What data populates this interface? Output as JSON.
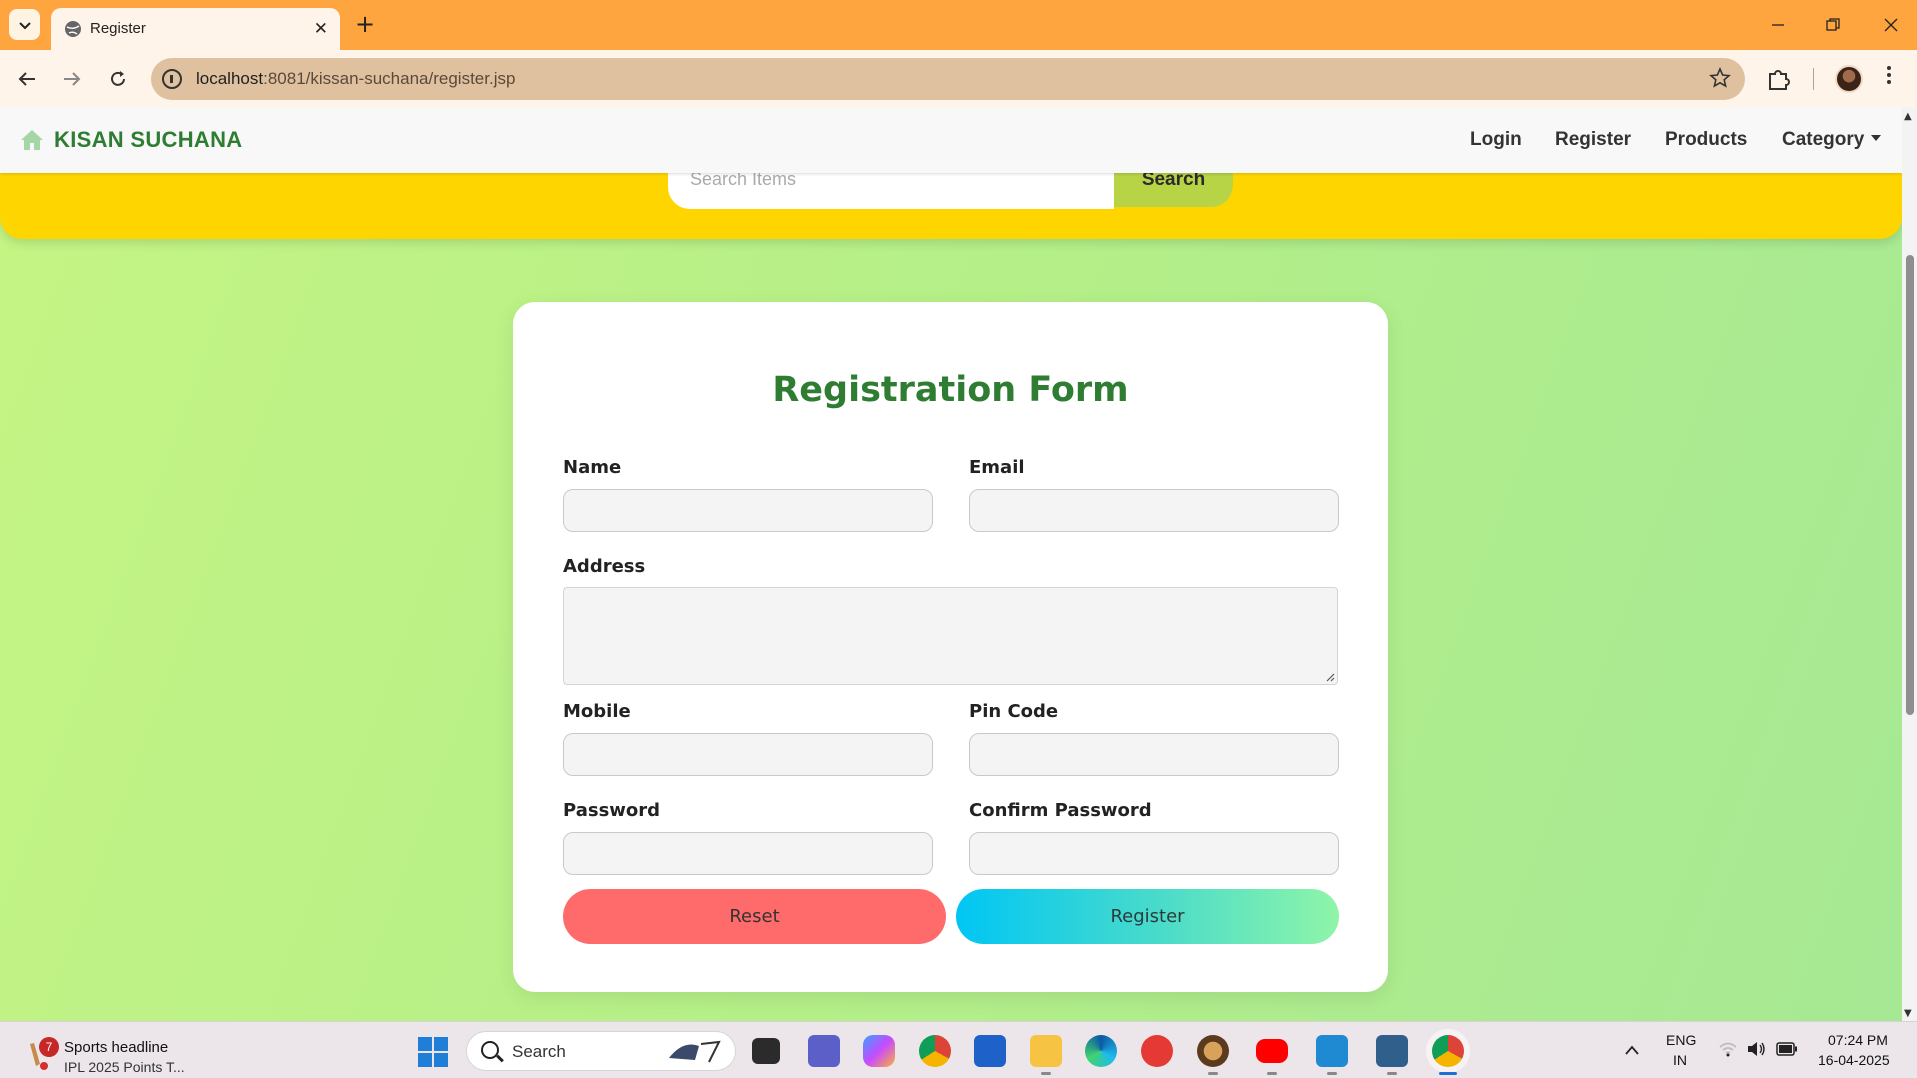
{
  "browser": {
    "tab_title": "Register",
    "close_tab": "✕",
    "new_tab": "+",
    "url_host": "localhost",
    "url_path": ":8081/kissan-suchana/register.jsp"
  },
  "navbar": {
    "brand": "KISAN SUCHANA",
    "links": [
      "Login",
      "Register",
      "Products",
      "Category"
    ]
  },
  "search": {
    "placeholder": "Search Items",
    "button": "Search"
  },
  "form": {
    "title": "Registration Form",
    "name_label": "Name",
    "email_label": "Email",
    "address_label": "Address",
    "mobile_label": "Mobile",
    "pincode_label": "Pin Code",
    "password_label": "Password",
    "confirm_password_label": "Confirm Password",
    "reset_button": "Reset",
    "register_button": "Register"
  },
  "taskbar": {
    "news_badge": "7",
    "news_title": "Sports headline",
    "news_subtitle": "IPL 2025 Points T...",
    "search_placeholder": "Search",
    "language_line1": "ENG",
    "language_line2": "IN",
    "time": "07:24 PM",
    "date": "16-04-2025"
  },
  "colors": {
    "tabbar": "#ffa53f",
    "hero_band": "#ffd500",
    "brand_green": "#2e7d32",
    "reset_red": "#ff6b6b",
    "register_gradient_start": "#00c6f4",
    "register_gradient_end": "#8ff5a8"
  }
}
